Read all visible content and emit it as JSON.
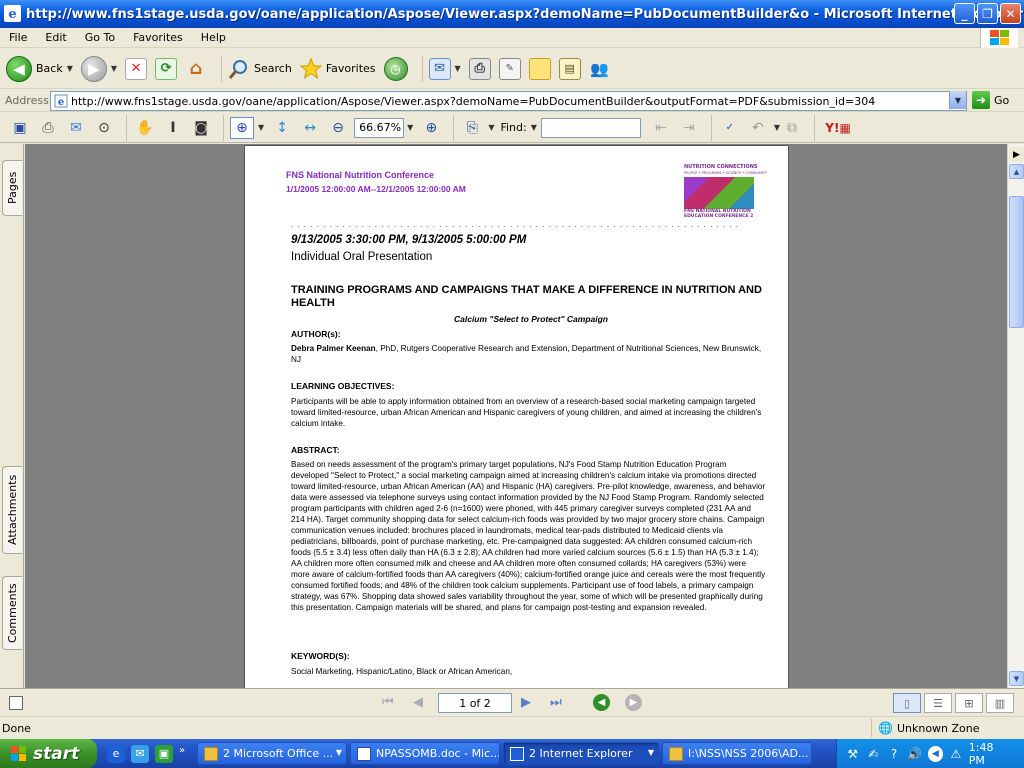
{
  "window": {
    "title": "http://www.fns1stage.usda.gov/oane/application/Aspose/Viewer.aspx?demoName=PubDocumentBuilder&o - Microsoft Internet Explorer",
    "minimize": "_",
    "restore": "❐",
    "close": "✕"
  },
  "menu": {
    "file": "File",
    "edit": "Edit",
    "goto": "Go To",
    "favorites": "Favorites",
    "help": "Help"
  },
  "toolbar": {
    "back": "Back",
    "search": "Search",
    "favorites": "Favorites"
  },
  "address": {
    "label": "Address",
    "url": "http://www.fns1stage.usda.gov/oane/application/Aspose/Viewer.aspx?demoName=PubDocumentBuilder&outputFormat=PDF&submission_id=304",
    "go": "Go"
  },
  "pdf_toolbar": {
    "zoom": "66.67%",
    "find_label": "Find:",
    "find_value": ""
  },
  "side_tabs": {
    "pages": "Pages",
    "attachments": "Attachments",
    "comments": "Comments"
  },
  "doc": {
    "conference_name": "FNS National Nutrition Conference",
    "conference_dates": "1/1/2005 12:00:00 AM--12/1/2005 12:00:00 AM",
    "logo_top": "NUTRITION CONNECTIONS",
    "logo_tag": "PEOPLE • PROGRAMS • SCIENCE • COMMUNITY",
    "logo_bottom": "FNS NATIONAL NUTRITION EDUCATION CONFERENCE 2",
    "dots": ". . . . . . . . . . . . . . . . . . . . . . . . . . . . . . . . . . . . . . . . . . . . . . . . . . . . . . . . . . . . . . . . . . . . . . . . . . . . . .",
    "session_time": "9/13/2005 3:30:00 PM, 9/13/2005 5:00:00 PM",
    "session_type": "Individual Oral Presentation",
    "track_title": "TRAINING PROGRAMS AND CAMPAIGNS THAT MAKE A DIFFERENCE IN NUTRITION AND HEALTH",
    "subtitle": "Calcium \"Select to Protect\" Campaign",
    "authors_heading": "AUTHOR(s):",
    "author_name": "Debra Palmer Keenan",
    "author_affil": ", PhD, Rutgers Cooperative Research and Extension, Department of Nutritional Sciences, New Brunswick, NJ",
    "objectives_heading": "LEARNING OBJECTIVES:",
    "objectives_text": "Participants will be able to apply information obtained from an overview of a research-based social marketing campaign targeted toward limited-resource, urban African American and Hispanic caregivers of young children, and aimed at increasing the children's calcium intake.",
    "abstract_heading": "ABSTRACT:",
    "abstract_text": "Based on needs assessment of the program's primary target populations, NJ's Food Stamp Nutrition Education Program developed \"Select to Protect,\" a social marketing campaign aimed at increasing children's calcium intake via promotions directed toward limited-resource, urban African American (AA) and Hispanic (HA) caregivers. Pre-pilot knowledge, awareness, and behavior data were assessed via telephone surveys using contact information provided by the NJ Food Stamp Program. Randomly selected program participants with children aged 2-6 (n=1600) were phoned, with 445 primary caregiver surveys completed (231 AA and 214 HA). Target community shopping data for select calcium-rich foods was provided by two major grocery store chains. Campaign communication venues included: brochures placed in laundromats, medical tear-pads distributed to Medicaid clients via pediatricians, billboards, point of purchase marketing, etc. Pre-campaigned data suggested: AA children consumed calcium-rich foods (5.5 ± 3.4) less often daily than HA (6.3 ± 2.8); AA children had more varied calcium sources (5.6 ± 1.5) than HA (5.3 ± 1.4); AA children more often consumed milk and cheese and AA children more often consumed collards; HA caregivers (53%) were more aware of calcium-fortified foods than AA caregivers (40%); calcium-fortified orange juice and cereals were the most frequently consumed fortified foods; and 48% of the children took calcium supplements. Participant use of food labels, a primary campaign strategy, was 67%. Shopping data showed sales variability throughout the year, some of which will be presented graphically during this presentation. Campaign materials will be shared, and plans for campaign post-testing and expansion revealed.",
    "keywords_heading": "KEYWORD(S):",
    "keywords_text": "Social Marketing, Hispanic/Latino, Black or African American,"
  },
  "nav": {
    "page_indicator": "1 of 2"
  },
  "status": {
    "text": "Done",
    "zone": "Unknown Zone"
  },
  "taskbar": {
    "start": "start",
    "tasks": [
      "2 Microsoft Office ...",
      "NPASSOMB.doc - Mic...",
      "2 Internet Explorer",
      "I:\\NSS\\NSS 2006\\AD..."
    ],
    "clock": "1:48 PM"
  }
}
